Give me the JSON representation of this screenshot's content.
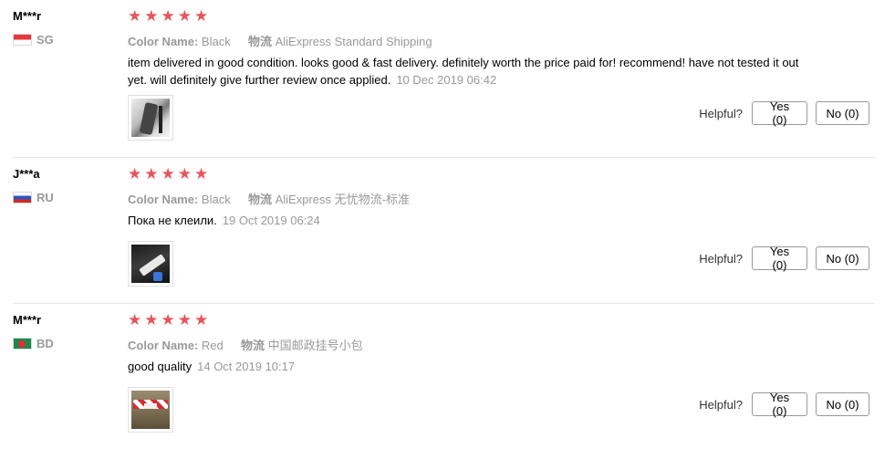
{
  "helpful_label": "Helpful?",
  "star_glyph": "★",
  "colors": {
    "star": "#e6555c",
    "muted": "#999999"
  },
  "reviews": [
    {
      "user": "M***r",
      "country": "SG",
      "flag": "singapore-flag-icon",
      "rating": 5,
      "color_label": "Color Name:",
      "color_value": "Black",
      "shipping_label": "物流",
      "shipping_value": "AliExpress Standard Shipping",
      "text": "item delivered in good condition. looks good & fast delivery. definitely worth the price paid for! recommend! have not tested it out yet. will definitely give further review once applied.",
      "date": "10 Dec 2019 06:42",
      "yes": "Yes (0)",
      "no": "No (0)"
    },
    {
      "user": "J***a",
      "country": "RU",
      "flag": "russia-flag-icon",
      "rating": 5,
      "color_label": "Color Name:",
      "color_value": "Black",
      "shipping_label": "物流",
      "shipping_value": "AliExpress 无忧物流-标准",
      "text": "Пока не клеили.",
      "date": "19 Oct 2019 06:24",
      "yes": "Yes (0)",
      "no": "No (0)"
    },
    {
      "user": "M***r",
      "country": "BD",
      "flag": "bangladesh-flag-icon",
      "rating": 5,
      "color_label": "Color Name:",
      "color_value": "Red",
      "shipping_label": "物流",
      "shipping_value": "中国邮政挂号小包",
      "text": "good quality",
      "date": "14 Oct 2019 10:17",
      "yes": "Yes (0)",
      "no": "No (0)"
    }
  ]
}
